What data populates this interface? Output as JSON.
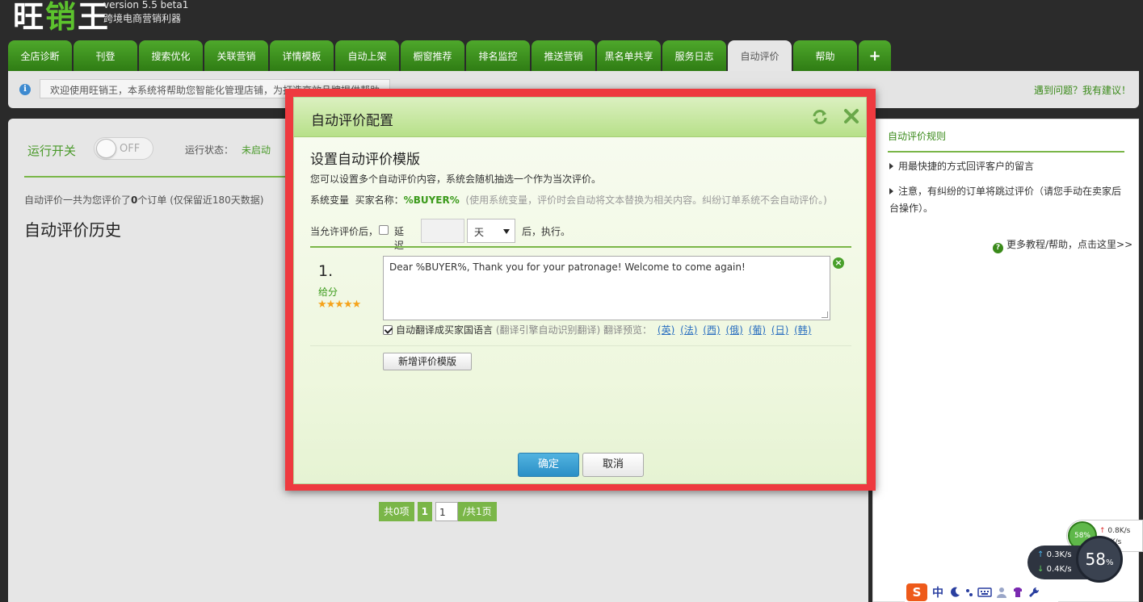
{
  "header": {
    "logo": "旺销王",
    "version": "version 5.5 beta1",
    "tagline": "跨境电商营销利器"
  },
  "tabs": [
    {
      "label": "全店诊断"
    },
    {
      "label": "刊登"
    },
    {
      "label": "搜索优化"
    },
    {
      "label": "关联营销"
    },
    {
      "label": "详情模板"
    },
    {
      "label": "自动上架"
    },
    {
      "label": "橱窗推荐"
    },
    {
      "label": "排名监控"
    },
    {
      "label": "推送营销"
    },
    {
      "label": "黑名单共享"
    },
    {
      "label": "服务日志"
    },
    {
      "label": "自动评价",
      "active": true
    },
    {
      "label": "帮助"
    },
    {
      "label": "+"
    }
  ],
  "infobar": {
    "welcome": "欢迎使用旺销王，本系统将帮助您智能化管理店铺，为打造高效品牌提供帮助。",
    "feedback": "遇到问题？我有建议！"
  },
  "main": {
    "run_label": "运行开关",
    "toggle_text": "OFF",
    "status_label": "运行状态：",
    "status_value": "未启动",
    "summary_prefix": "自动评价一共为您评价了",
    "summary_count": "0",
    "summary_suffix": "个订单 (仅保留近180天数据)",
    "history_title": "自动评价历史",
    "pager": {
      "count": "共0项",
      "page": "1",
      "input": "1",
      "total": "/共1页"
    }
  },
  "side": {
    "title": "自动评价规则",
    "rules": [
      "用最快捷的方式回评客户的留言",
      "注意，有纠纷的订单将跳过评价（请您手动在卖家后台操作）。"
    ],
    "help": "更多教程/帮助，点击这里>>"
  },
  "modal": {
    "title": "自动评价配置",
    "section_title": "设置自动评价模版",
    "desc": "您可以设置多个自动评价内容，系统会随机抽选一个作为当次评价。",
    "var_label": "系统变量",
    "var_buyer_label": "买家名称：",
    "var_buyer": "%BUYER%",
    "var_hint": "(使用系统变量，评价时会自动将文本替换为相关内容。纠纷订单系统不会自动评价。)",
    "delay_prefix": "当允许评价后，",
    "delay_label": "延迟",
    "delay_value": "",
    "delay_unit": "天",
    "delay_suffix": "后，执行。",
    "item": {
      "number": "1.",
      "score_label": "给分",
      "stars": "★★★★★",
      "rating": 5,
      "text": "Dear %BUYER%, Thank you for your patronage! Welcome to come again!",
      "translate_label": "自动翻译成买家国语言",
      "translate_hint": "(翻译引擎自动识别翻译)",
      "preview_label": "翻译预览：",
      "languages": [
        "(英)",
        "(法)",
        "(西)",
        "(俄)",
        "(葡)",
        "(日)",
        "(韩)"
      ]
    },
    "add_button": "新增评价模版",
    "ok_button": "确定",
    "cancel_button": "取消"
  },
  "netmon": {
    "mini_percent": "58%",
    "up_small": "0.8K/s",
    "down_small": "3K/s",
    "up": "0.3K/s",
    "down": "0.4K/s",
    "big_percent": "58",
    "big_unit": "%"
  },
  "ime": {
    "logo": "S",
    "lang": "中"
  }
}
